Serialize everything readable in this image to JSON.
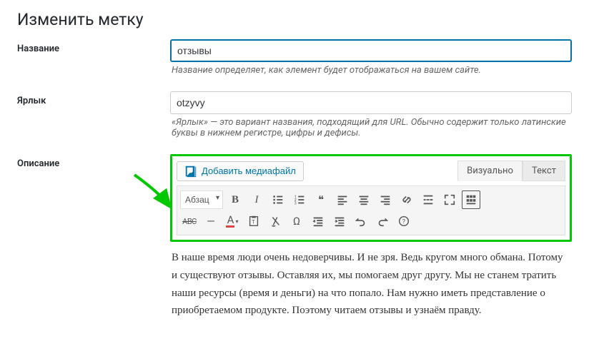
{
  "page_title": "Изменить метку",
  "name": {
    "label": "Название",
    "value": "отзывы",
    "desc": "Название определяет, как элемент будет отображаться на вашем сайте."
  },
  "slug": {
    "label": "Ярлык",
    "value": "otzyvy",
    "desc": "«Ярлык» — это вариант названия, подходящий для URL. Обычно содержит только латинские буквы в нижнем регистре, цифры и дефисы."
  },
  "description": {
    "label": "Описание",
    "add_media": "Добавить медиафайл",
    "tab_visual": "Визуально",
    "tab_text": "Текст",
    "format_select": "Абзац",
    "content": "В наше время люди очень недоверчивы. И не зря. Ведь кругом много обмана. Потому и существуют отзывы. Оставляя их, мы помогаем друг другу. Мы не станем тратить наши ресурсы (время и деньги) на что попало. Нам нужно иметь представление о приобретаемом продукте. Поэтому читаем отзывы и узнаём правду."
  },
  "icons": {
    "bold": "B",
    "italic": "I",
    "abc": "ABC",
    "quote": "❝",
    "omega": "Ω",
    "dash": "—",
    "help": "?",
    "textcolor": "A"
  }
}
